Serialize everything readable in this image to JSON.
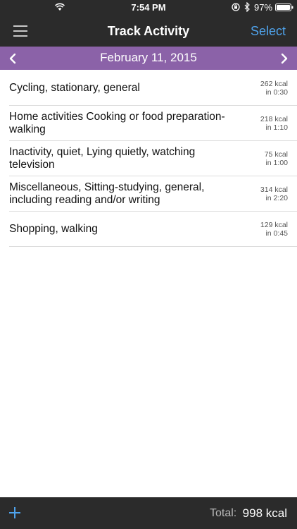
{
  "status_bar": {
    "time": "7:54 PM",
    "battery": "97%"
  },
  "nav": {
    "title": "Track Activity",
    "select_label": "Select"
  },
  "date_bar": {
    "date": "February 11, 2015"
  },
  "activities": [
    {
      "name": "Cycling, stationary, general",
      "kcal": "262 kcal",
      "duration": "in 0:30"
    },
    {
      "name": "Home activities Cooking or food preparation-walking",
      "kcal": "218 kcal",
      "duration": "in 1:10"
    },
    {
      "name": "Inactivity, quiet, Lying quietly, watching television",
      "kcal": "75 kcal",
      "duration": "in 1:00"
    },
    {
      "name": "Miscellaneous, Sitting-studying, general, including reading and/or writing",
      "kcal": "314 kcal",
      "duration": "in 2:20"
    },
    {
      "name": "Shopping, walking",
      "kcal": "129 kcal",
      "duration": "in 0:45"
    }
  ],
  "bottom_bar": {
    "total_label": "Total:",
    "total_value": "998 kcal"
  },
  "colors": {
    "bar_dark": "#2b2b2b",
    "date_bar": "#8b62a8",
    "accent_blue": "#4fa3ec"
  }
}
